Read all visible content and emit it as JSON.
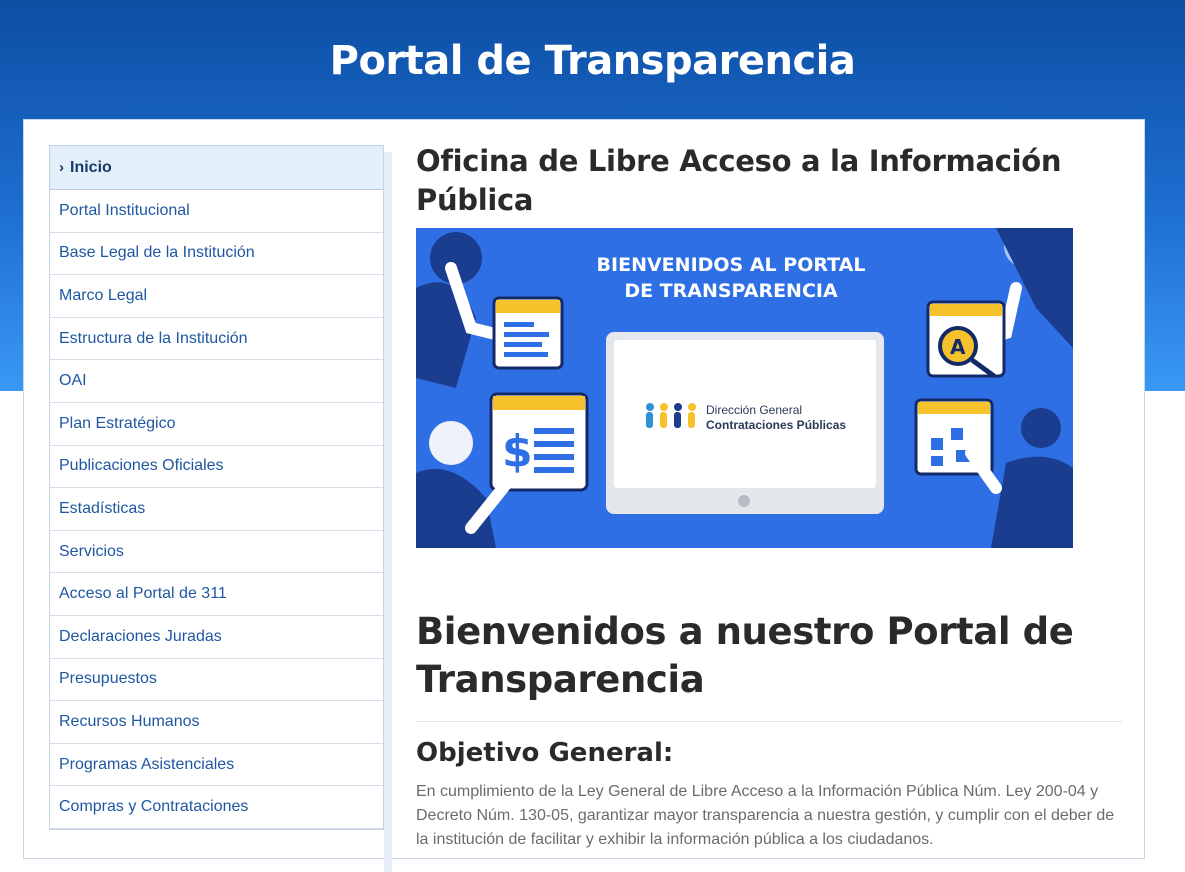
{
  "site": {
    "title": "Portal de Transparencia"
  },
  "sidebar": {
    "items": [
      {
        "label": "Inicio",
        "active": true
      },
      {
        "label": "Portal Institucional"
      },
      {
        "label": "Base Legal de la Institución"
      },
      {
        "label": "Marco Legal"
      },
      {
        "label": "Estructura de la Institución"
      },
      {
        "label": "OAI"
      },
      {
        "label": "Plan Estratégico"
      },
      {
        "label": "Publicaciones Oficiales"
      },
      {
        "label": "Estadísticas"
      },
      {
        "label": "Servicios"
      },
      {
        "label": "Acceso al Portal de 311"
      },
      {
        "label": "Declaraciones Juradas"
      },
      {
        "label": "Presupuestos"
      },
      {
        "label": "Recursos Humanos"
      },
      {
        "label": "Programas Asistenciales"
      },
      {
        "label": "Compras y Contrataciones"
      }
    ]
  },
  "main": {
    "office_title": "Oficina de Libre Acceso a la Información Pública",
    "banner": {
      "line1": "BIENVENIDOS AL PORTAL",
      "line2": "DE TRANSPARENCIA",
      "logo_line1": "Dirección General",
      "logo_line2": "Contrataciones Públicas"
    },
    "welcome_title": "Bienvenidos a nuestro Portal de Transparencia",
    "objective_title": "Objetivo General:",
    "objective_text": "En cumplimiento de la Ley General de Libre Acceso a la Información Pública Núm. Ley 200-04 y Decreto Núm. 130-05, garantizar mayor transparencia a nuestra gestión, y cumplir con el deber de la institución de facilitar y exhibir la información pública a los ciudadanos."
  },
  "colors": {
    "header_top": "#0d4ea3",
    "header_bottom": "#3a98f5",
    "link": "#1f57a2",
    "active_bg": "#e3f0fc",
    "banner_bg": "#2f6fe6"
  }
}
